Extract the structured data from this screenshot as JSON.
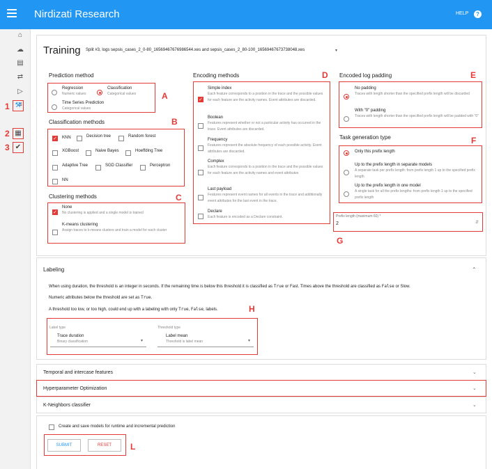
{
  "app": {
    "title": "Nirdizati Research",
    "help_label": "HELP"
  },
  "sidebar": {
    "icons": [
      "home-icon",
      "cloud-upload-icon",
      "document-icon",
      "compare-arrows-icon",
      "label-icon",
      "list-icon",
      "wrench-icon",
      "chart-icon",
      "check-circle-icon"
    ],
    "callouts": [
      "1",
      "2",
      "3"
    ]
  },
  "training": {
    "title": "Training",
    "split": "Split #3, logs sepsis_cases_2_0-80_16569467676986544.xes and sepsis_cases_2_80-100_16569467673738048.xes"
  },
  "prediction": {
    "title": "Prediction method",
    "callout": "A",
    "options": [
      {
        "label": "Regression",
        "sub": "Numeric values"
      },
      {
        "label": "Classification",
        "sub": "Categorical values"
      },
      {
        "label": "Time Series Prediction",
        "sub": "Categorical values"
      }
    ],
    "selected": "Classification"
  },
  "classification": {
    "title": "Classification methods",
    "callout": "B",
    "options": [
      "KNN",
      "Decision tree",
      "Random forest",
      "XGBoost",
      "Naive Bayes",
      "Hoeffding Tree",
      "Adaptive Tree",
      "SGD Classifier",
      "Perceptron",
      "NN"
    ],
    "selected": [
      "KNN"
    ]
  },
  "clustering": {
    "title": "Clustering methods",
    "callout": "C",
    "options": [
      {
        "label": "None",
        "sub": "No clustering is applied and a single model is trained"
      },
      {
        "label": "K-means clustering",
        "sub": "Assign traces to k-means clusters and train a model for each cluster"
      }
    ],
    "selected": [
      "None"
    ]
  },
  "encoding": {
    "title": "Encoding methods",
    "callout": "D",
    "options": [
      {
        "label": "Simple index",
        "sub": "Each feature corresponds to a position in the trace and the possible values for each feature are the activity names. Event attributes are discarded."
      },
      {
        "label": "Boolean",
        "sub": "Features represent whether or not a particular activity has occurred in the trace. Event attributes are discarded."
      },
      {
        "label": "Frequency",
        "sub": "Features represent the absolute frequency of each possible activity. Event attributes are discarded."
      },
      {
        "label": "Complex",
        "sub": "Each feature corresponds to a position in the trace and the possible values for each feature are the activity names and event attributes"
      },
      {
        "label": "Last payload",
        "sub": "Features represent event names for all events in the trace and additionally event attributes for the last event in the trace."
      },
      {
        "label": "Declare",
        "sub": "Each feature is encoded as a Declare constraint."
      }
    ],
    "selected": [
      "Simple index"
    ]
  },
  "padding": {
    "title": "Encoded log padding",
    "callout": "E",
    "options": [
      {
        "label": "No padding",
        "sub": "Traces with length shorter than the specified prefix length will be discarded"
      },
      {
        "label": "With \"0\" padding",
        "sub": "Traces with length shorter than the specified prefix length will be padded with \"0\""
      }
    ],
    "selected": "No padding"
  },
  "task": {
    "title": "Task generation type",
    "callout": "F",
    "options": [
      {
        "label": "Only this prefix length",
        "sub": ""
      },
      {
        "label": "Up to the prefix length in separate models",
        "sub": "A separate task per prefix length: from prefix length 1 up to the specified prefix length"
      },
      {
        "label": "Up to the prefix length in one model",
        "sub": "A single task for all the prefix lengths: from prefix length 1 up to the specified prefix length"
      }
    ],
    "selected": "Only this prefix length"
  },
  "prefix": {
    "label": "Prefix length (maximum 60) *",
    "value": "2",
    "callout": "G"
  },
  "labeling": {
    "title": "Labeling",
    "p1a": "When using duration, the threshold is an integer in seconds. If the remaining time is below this threshold it is classified as",
    "code_true": "True",
    "p1b": "or Fast. Times above the threshold are classified as",
    "code_false": "False",
    "p1c": "or Slow.",
    "p2a": "Numeric attributes below the threshold are set as",
    "p2b": ".",
    "p3a": "A threshold too low, or too high, could end up with a labeling with only",
    "p3b": ",",
    "p3c": "labels.",
    "callout": "H",
    "label_type": {
      "label": "Label type",
      "value": "Trace duration",
      "sub": "Binary classification"
    },
    "threshold_type": {
      "label": "Threshold type",
      "value": "Label mean",
      "sub": "Threshold is label mean"
    }
  },
  "sections": [
    "Temporal and intercase features",
    "Hyperparameter Optimization",
    "K-Neighbors classifier"
  ],
  "footer": {
    "checkbox": "Create and save models for runtime and incremental prediction",
    "submit": "SUBMIT",
    "reset": "RESET",
    "callout": "L"
  },
  "colors": {
    "primary": "#2196f3",
    "accent": "#e53935"
  }
}
